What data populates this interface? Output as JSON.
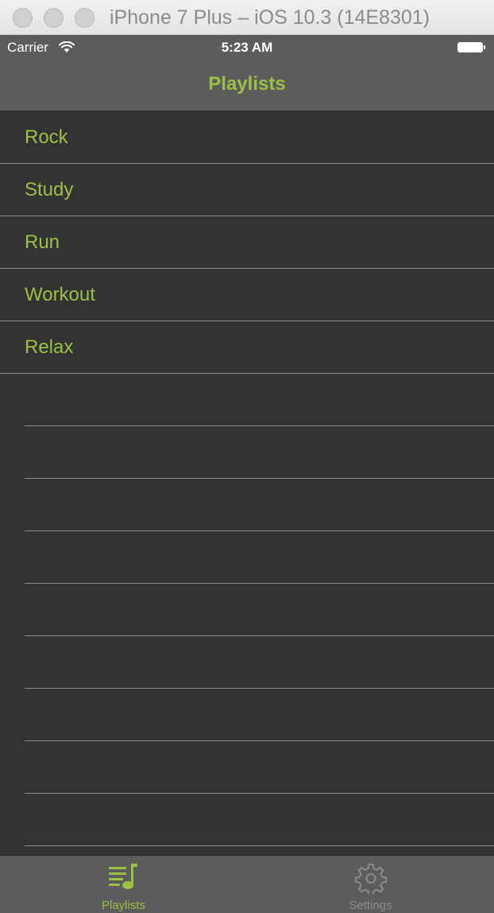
{
  "window": {
    "title": "iPhone 7 Plus – iOS 10.3 (14E8301)"
  },
  "status_bar": {
    "carrier": "Carrier",
    "time": "5:23 AM",
    "wifi_icon": "wifi-icon",
    "battery_icon": "battery-icon"
  },
  "nav": {
    "title": "Playlists"
  },
  "playlists": [
    {
      "label": "Rock"
    },
    {
      "label": "Study"
    },
    {
      "label": "Run"
    },
    {
      "label": "Workout"
    },
    {
      "label": "Relax"
    }
  ],
  "tab_bar": {
    "tabs": [
      {
        "label": "Playlists",
        "icon": "playlist-icon",
        "selected": true
      },
      {
        "label": "Settings",
        "icon": "gear-icon",
        "selected": false
      }
    ]
  },
  "colors": {
    "accent": "#9ac144",
    "bar_background": "#5c5c5c",
    "table_background": "#333333",
    "separator": "#8c8c8c",
    "inactive_tab": "#8c8c8c"
  }
}
